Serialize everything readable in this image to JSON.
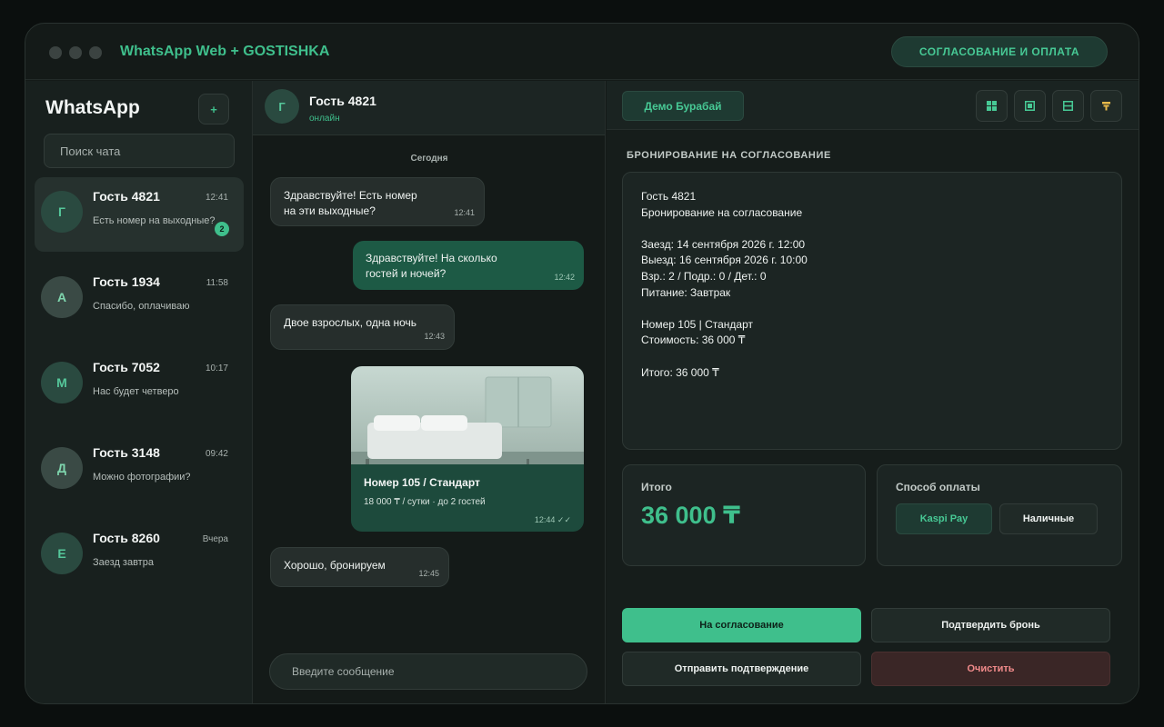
{
  "app": {
    "title": "WhatsApp Web + GOSTISHKA",
    "top_action": "СОГЛАСОВАНИЕ И ОПЛАТА"
  },
  "sidebar": {
    "title": "WhatsApp",
    "add_label": "+",
    "search_placeholder": "Поиск чата",
    "chats": [
      {
        "initial": "Г",
        "name": "Гость 4821",
        "time": "12:41",
        "preview": "Есть номер на выходные?",
        "unread": "2"
      },
      {
        "initial": "А",
        "name": "Гость 1934",
        "time": "11:58",
        "preview": "Спасибо, оплачиваю"
      },
      {
        "initial": "М",
        "name": "Гость 7052",
        "time": "10:17",
        "preview": "Нас будет четверо"
      },
      {
        "initial": "Д",
        "name": "Гость 3148",
        "time": "09:42",
        "preview": "Можно фотографии?"
      },
      {
        "initial": "Е",
        "name": "Гость 8260",
        "time": "Вчера",
        "preview": "Заезд завтра"
      }
    ]
  },
  "chat": {
    "header": {
      "initial": "Г",
      "name": "Гость 4821",
      "status": "онлайн"
    },
    "day_separator": "Сегодня",
    "messages": [
      {
        "dir": "in",
        "text": "Здравствуйте! Есть номер\nна эти выходные?",
        "time": "12:41"
      },
      {
        "dir": "out",
        "text": "Здравствуйте! На сколько\nгостей и ночей?",
        "time": "12:42"
      },
      {
        "dir": "in",
        "text": "Двое взрослых, одна ночь",
        "time": "12:43"
      },
      {
        "dir": "in",
        "text": "Хорошо, бронируем",
        "time": "12:45"
      }
    ],
    "room_card": {
      "title": "Номер 105 / Стандарт",
      "subtitle": "18 000 ₸ / сутки · до 2 гостей",
      "time": "12:44 ✓✓"
    },
    "composer_placeholder": "Введите сообщение"
  },
  "panel": {
    "demo_label": "Демо Бурабай",
    "tools": [
      "grid-icon",
      "frame-icon",
      "list-icon",
      "pin-icon"
    ],
    "heading": "БРОНИРОВАНИЕ НА СОГЛАСОВАНИЕ",
    "summary_lines": [
      "Гость 4821",
      "Бронирование на согласование",
      "",
      "Заезд: 14 сентября 2026 г. 12:00",
      "Выезд: 16 сентября 2026 г. 10:00",
      "Взр.: 2 / Подр.: 0 / Дет.: 0",
      "Питание: Завтрак",
      "",
      "Номер 105 | Стандарт",
      "Стоимость: 36 000 ₸",
      "",
      "Итого: 36 000 ₸"
    ],
    "total_label": "Итого",
    "total_value": "36 000 ₸",
    "payment_label": "Способ оплаты",
    "payment_options": [
      "Kaspi Pay",
      "Наличные"
    ],
    "actions": {
      "send_for_approval": "На согласование",
      "confirm": "Подтвердить бронь",
      "send_confirmation": "Отправить подтверждение",
      "clear": "Очистить"
    }
  },
  "colors": {
    "accent": "#3fbf8c",
    "danger": "#f08a8a",
    "bubble_out": "#1d5a45"
  }
}
